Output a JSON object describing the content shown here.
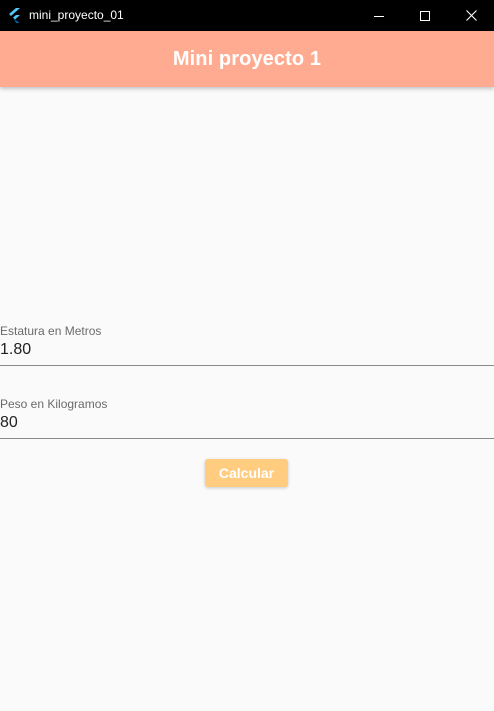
{
  "window": {
    "title": "mini_proyecto_01",
    "app_icon": "flutter-icon",
    "controls": [
      "minimize-icon",
      "maximize-icon",
      "close-icon"
    ]
  },
  "appbar": {
    "title": "Mini proyecto 1",
    "color": "#ffab91"
  },
  "form": {
    "height_field": {
      "label": "Estatura en Metros",
      "value": "1.80"
    },
    "weight_field": {
      "label": "Peso en Kilogramos",
      "value": "80"
    },
    "calculate_button": {
      "label": "Calcular",
      "color": "#ffcc80"
    }
  }
}
